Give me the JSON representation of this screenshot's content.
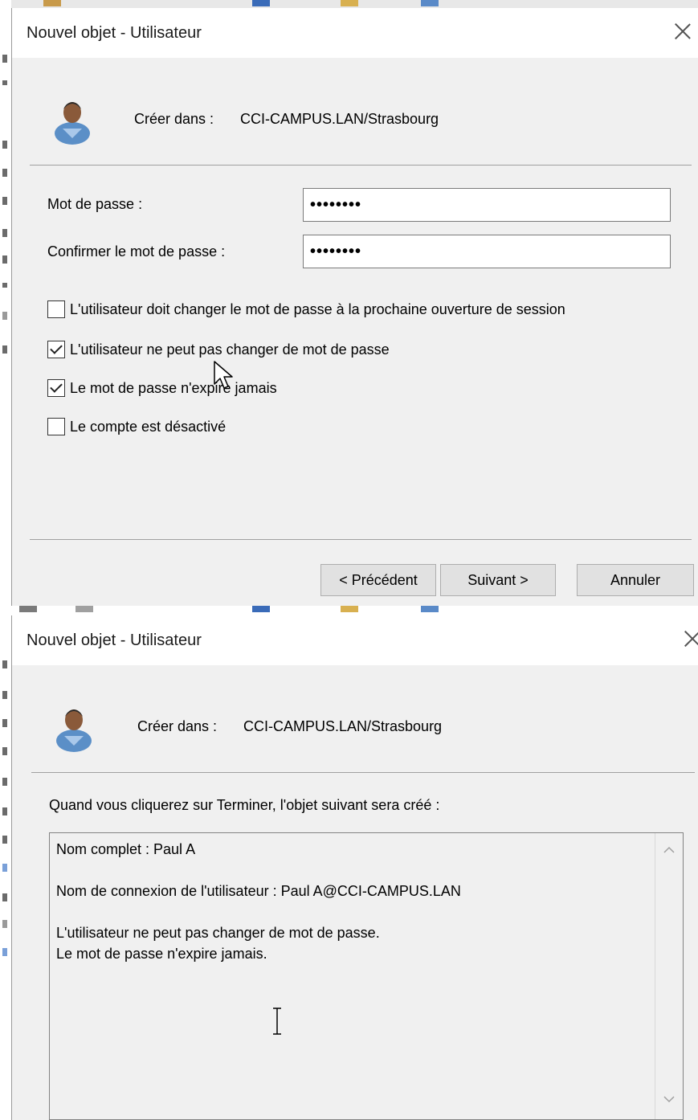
{
  "panel1": {
    "title": "Nouvel objet - Utilisateur",
    "create_in_label": "Créer dans :",
    "create_in_value": "CCI-CAMPUS.LAN/Strasbourg",
    "password_label": "Mot de passe :",
    "password_value": "••••••••",
    "confirm_label": "Confirmer le mot de passe :",
    "confirm_value": "••••••••",
    "checkboxes": [
      {
        "label": "L'utilisateur doit changer le mot de passe à la prochaine ouverture de session",
        "checked": false
      },
      {
        "label": "L'utilisateur ne peut pas changer de mot de passe",
        "checked": true
      },
      {
        "label": "Le mot de passe n'expire jamais",
        "checked": true
      },
      {
        "label": "Le compte est désactivé",
        "checked": false
      }
    ],
    "buttons": {
      "previous": "< Précédent",
      "next": "Suivant >",
      "cancel": "Annuler"
    }
  },
  "panel2": {
    "title": "Nouvel objet - Utilisateur",
    "create_in_label": "Créer dans :",
    "create_in_value": "CCI-CAMPUS.LAN/Strasbourg",
    "intro": "Quand vous cliquerez sur Terminer, l'objet suivant sera créé :",
    "summary": {
      "full_name": "Nom complet : Paul A",
      "logon_name": "Nom de connexion de l'utilisateur : Paul A@CCI-CAMPUS.LAN",
      "line3": "L'utilisateur ne peut pas changer de mot de passe.",
      "line4": "Le mot de passe n'expire jamais."
    }
  },
  "colors": {
    "dialog_bg": "#f0f0f0",
    "titlebar_bg": "#ffffff",
    "button_bg": "#e1e1e1",
    "border": "#adadad"
  },
  "icons": [
    "user-icon",
    "close-icon",
    "mouse-pointer-icon",
    "ibeam-cursor-icon",
    "scroll-up-icon",
    "scroll-down-icon"
  ]
}
